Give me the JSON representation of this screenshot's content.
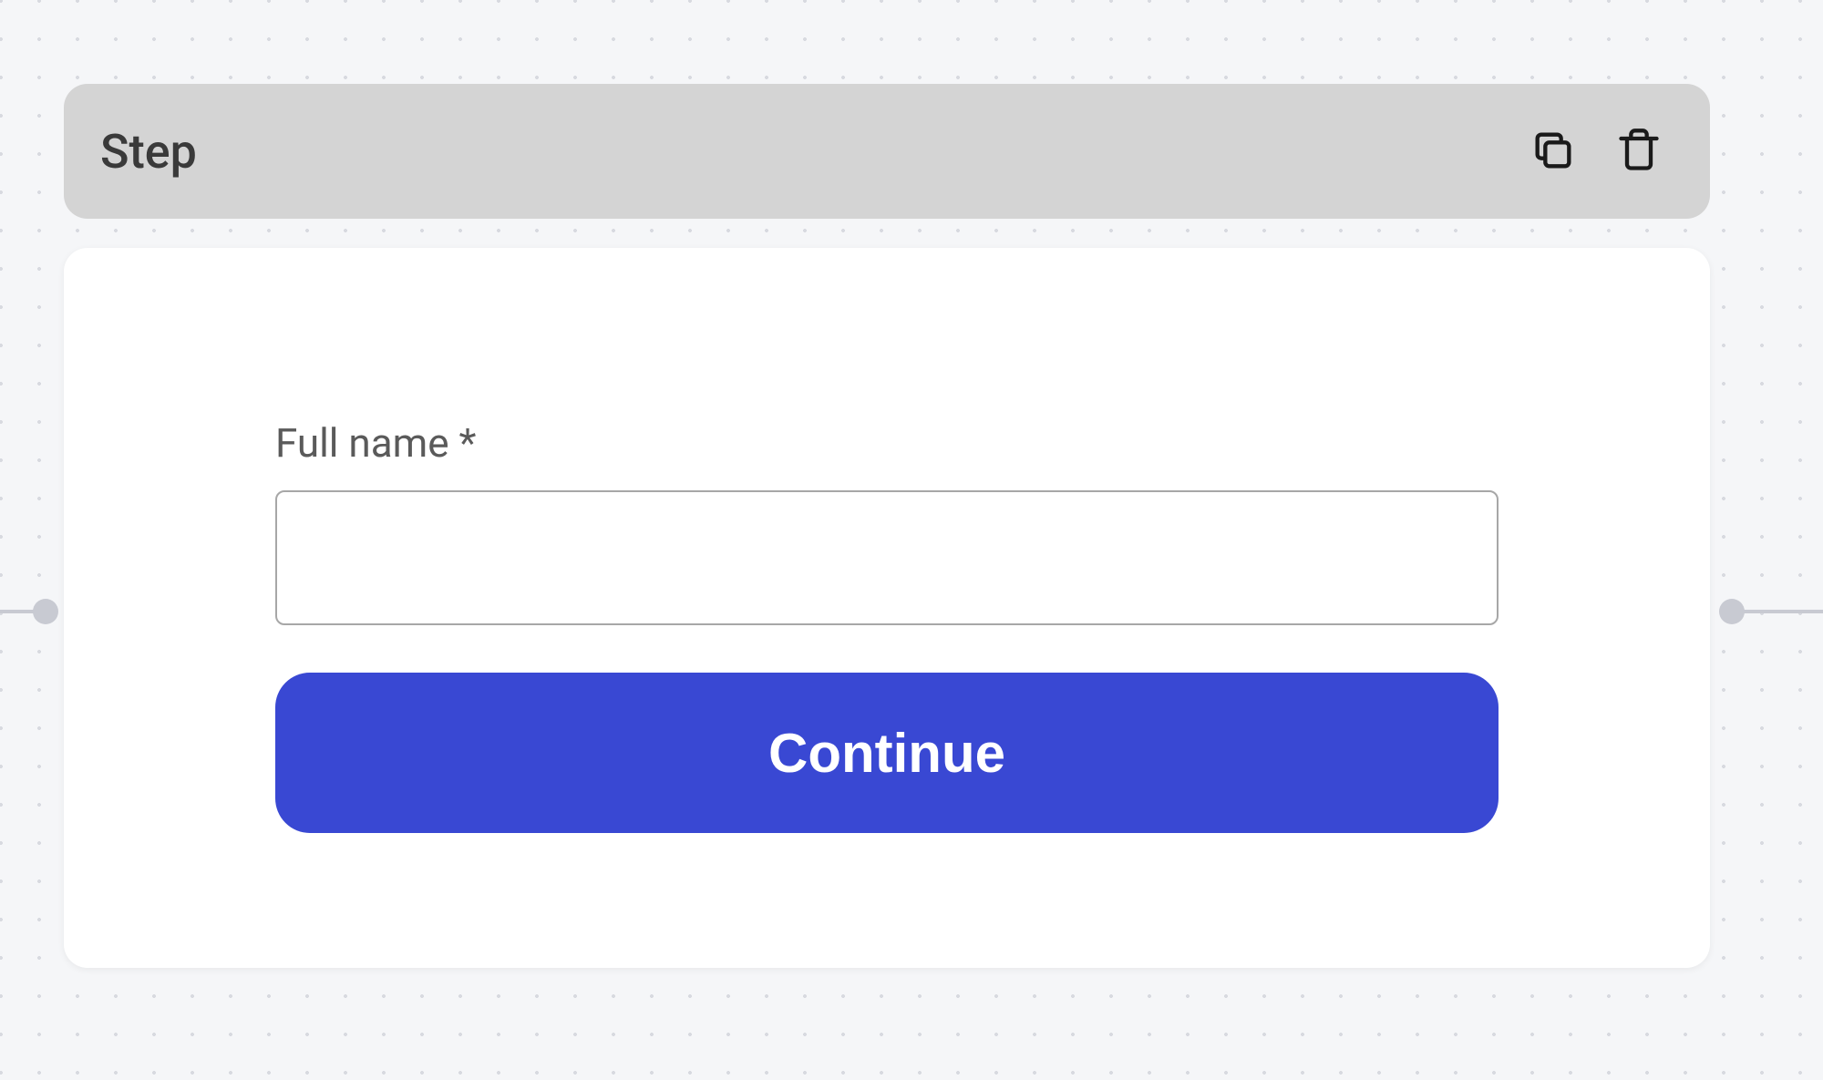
{
  "header": {
    "title": "Step",
    "icons": {
      "duplicate": "copy-icon",
      "delete": "trash-icon"
    }
  },
  "form": {
    "field": {
      "label": "Full name *",
      "value": ""
    },
    "submit_label": "Continue"
  },
  "colors": {
    "accent": "#3948d3",
    "header_bg": "#d4d4d4",
    "canvas_bg": "#f5f6f8"
  }
}
